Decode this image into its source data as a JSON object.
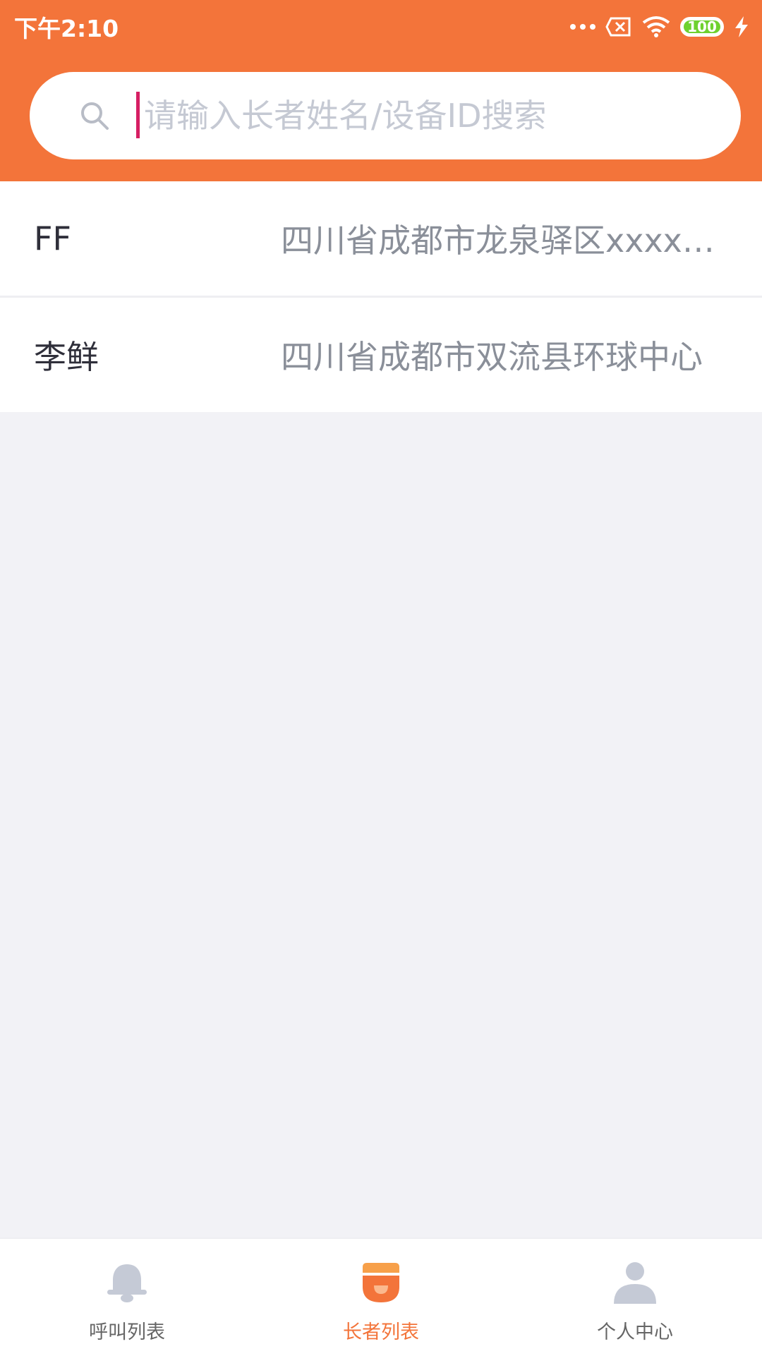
{
  "status_bar": {
    "time": "下午2:10",
    "battery": "100"
  },
  "search": {
    "placeholder": "请输入长者姓名/设备ID搜索",
    "value": ""
  },
  "elders": [
    {
      "name": "FF",
      "address": "四川省成都市龙泉驿区xxxxxxxxxx"
    },
    {
      "name": "李鲜",
      "address": "四川省成都市双流县环球中心"
    }
  ],
  "tabs": [
    {
      "label": "呼叫列表",
      "icon": "bell-icon",
      "active": false
    },
    {
      "label": "长者列表",
      "icon": "elder-icon",
      "active": true
    },
    {
      "label": "个人中心",
      "icon": "person-icon",
      "active": false
    }
  ],
  "colors": {
    "brand": "#f3743a",
    "inactive_icon": "#c5cad6",
    "caret": "#d61f63"
  }
}
